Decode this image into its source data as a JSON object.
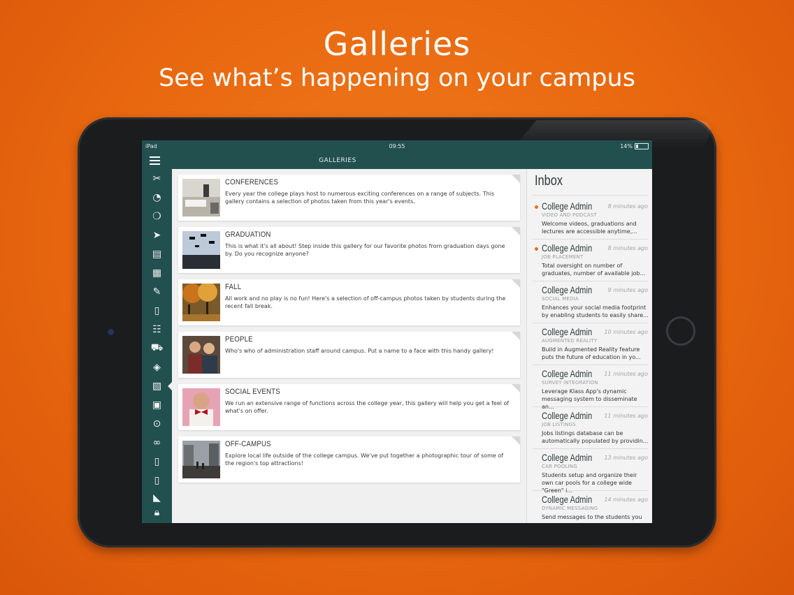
{
  "promo": {
    "title": "Galleries",
    "subtitle": "See what’s happening on your campus"
  },
  "status_bar": {
    "device": "iPad",
    "time": "09:55",
    "battery": "14%"
  },
  "nav": {
    "title": "GALLERIES"
  },
  "sidebar": {
    "items": [
      {
        "icon": "tools-icon"
      },
      {
        "icon": "dashboard-icon"
      },
      {
        "icon": "chat-icon"
      },
      {
        "icon": "announcements-icon"
      },
      {
        "icon": "news-icon"
      },
      {
        "icon": "calendar-icon"
      },
      {
        "icon": "edit-icon"
      },
      {
        "icon": "document-icon"
      },
      {
        "icon": "directory-icon"
      },
      {
        "icon": "car-icon"
      },
      {
        "icon": "layers-icon"
      },
      {
        "icon": "galleries-icon"
      },
      {
        "icon": "briefcase-icon"
      },
      {
        "icon": "play-icon"
      },
      {
        "icon": "link-icon"
      },
      {
        "icon": "file-icon"
      },
      {
        "icon": "file-icon"
      },
      {
        "icon": "flag-icon"
      },
      {
        "icon": "lock-icon"
      }
    ],
    "active": "galleries-icon"
  },
  "galleries": [
    {
      "title": "CONFERENCES",
      "description": "Every year the college plays host to numerous exciting conferences on a range of subjects.  This gallery contains a selection of photos taken from this year's events."
    },
    {
      "title": "GRADUATION",
      "description": "This is what it's all about!  Step inside this gallery for our favorite photos from graduation days gone by.  Do you recognize anyone?"
    },
    {
      "title": "FALL",
      "description": "All work and no play is no fun!  Here's a selection of off-campus photos taken by students during the recent fall break."
    },
    {
      "title": "PEOPLE",
      "description": "Who's who of administration staff around campus.  Put a name to a face with this handy gallery!"
    },
    {
      "title": "SOCIAL EVENTS",
      "description": "We run an extensive range of functions across the college year, this gallery will help you get a feel of what's on offer."
    },
    {
      "title": "OFF-CAMPUS",
      "description": "Explore local life outside of the college campus.  We've put together a photographic tour of some of the region's top attractions!"
    }
  ],
  "inbox": {
    "title": "Inbox",
    "messages": [
      {
        "sender": "College Admin",
        "time": "8 minutes ago",
        "category": "VIDEO AND PODCAST",
        "preview": "Welcome videos, graduations and lectures are accessible anytime,...",
        "unread": true
      },
      {
        "sender": "College Admin",
        "time": "8 minutes ago",
        "category": "JOB PLACEMENT",
        "preview": "Total oversight on number of graduates, number of available job...",
        "unread": true
      },
      {
        "sender": "College Admin",
        "time": "9 minutes ago",
        "category": "SOCIAL MEDIA",
        "preview": "Enhances your social media footprint by enabling students to easily share...",
        "unread": false
      },
      {
        "sender": "College Admin",
        "time": "10 minutes ago",
        "category": "AUGMENTED REALITY",
        "preview": "Build in Augmented Reality feature puts the future of education in yo...",
        "unread": false
      },
      {
        "sender": "College Admin",
        "time": "11 minutes ago",
        "category": "SURVEY INTEGRATION",
        "preview": "Leverage Klass App's dynamic messaging system to disseminate an...",
        "unread": false
      },
      {
        "sender": "College Admin",
        "time": "11 minutes ago",
        "category": "JOB LISTINGS",
        "preview": "Jobs listings database can be automatically populated by providin...",
        "unread": false
      },
      {
        "sender": "College Admin",
        "time": "13 minutes ago",
        "category": "CAR POOLING",
        "preview": "Students setup and organize their own car pools for a college wide \"Green\" i...",
        "unread": false
      },
      {
        "sender": "College Admin",
        "time": "14 minutes ago",
        "category": "DYNAMIC MESSAGING",
        "preview": "Send messages to the students you",
        "unread": false
      }
    ]
  },
  "colors": {
    "background": "#e8670f",
    "app_teal": "#22504f",
    "unread_dot": "#e07020"
  }
}
